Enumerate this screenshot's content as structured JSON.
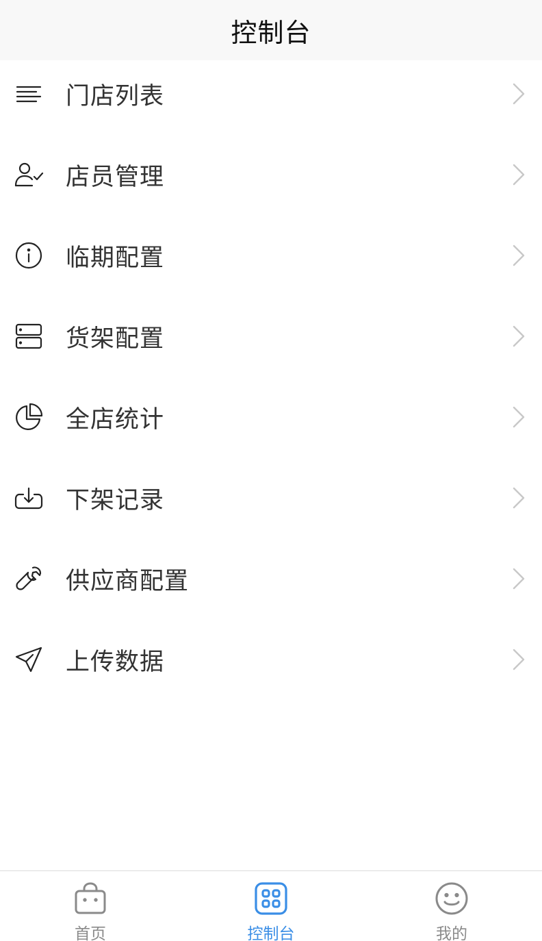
{
  "header": {
    "title": "控制台"
  },
  "menu": {
    "items": [
      {
        "label": "门店列表",
        "icon": "list-icon"
      },
      {
        "label": "店员管理",
        "icon": "user-check-icon"
      },
      {
        "label": "临期配置",
        "icon": "info-icon"
      },
      {
        "label": "货架配置",
        "icon": "server-icon"
      },
      {
        "label": "全店统计",
        "icon": "pie-chart-icon"
      },
      {
        "label": "下架记录",
        "icon": "download-icon"
      },
      {
        "label": "供应商配置",
        "icon": "wrench-icon"
      },
      {
        "label": "上传数据",
        "icon": "send-icon"
      }
    ]
  },
  "tabbar": {
    "tabs": [
      {
        "label": "首页",
        "icon": "shopping-bag-icon",
        "active": false
      },
      {
        "label": "控制台",
        "icon": "grid-icon",
        "active": true
      },
      {
        "label": "我的",
        "icon": "smile-icon",
        "active": false
      }
    ]
  },
  "colors": {
    "accent": "#3a8ee6",
    "text": "#333333",
    "inactive": "#8a8a8a",
    "header_bg": "#f8f8f8"
  }
}
